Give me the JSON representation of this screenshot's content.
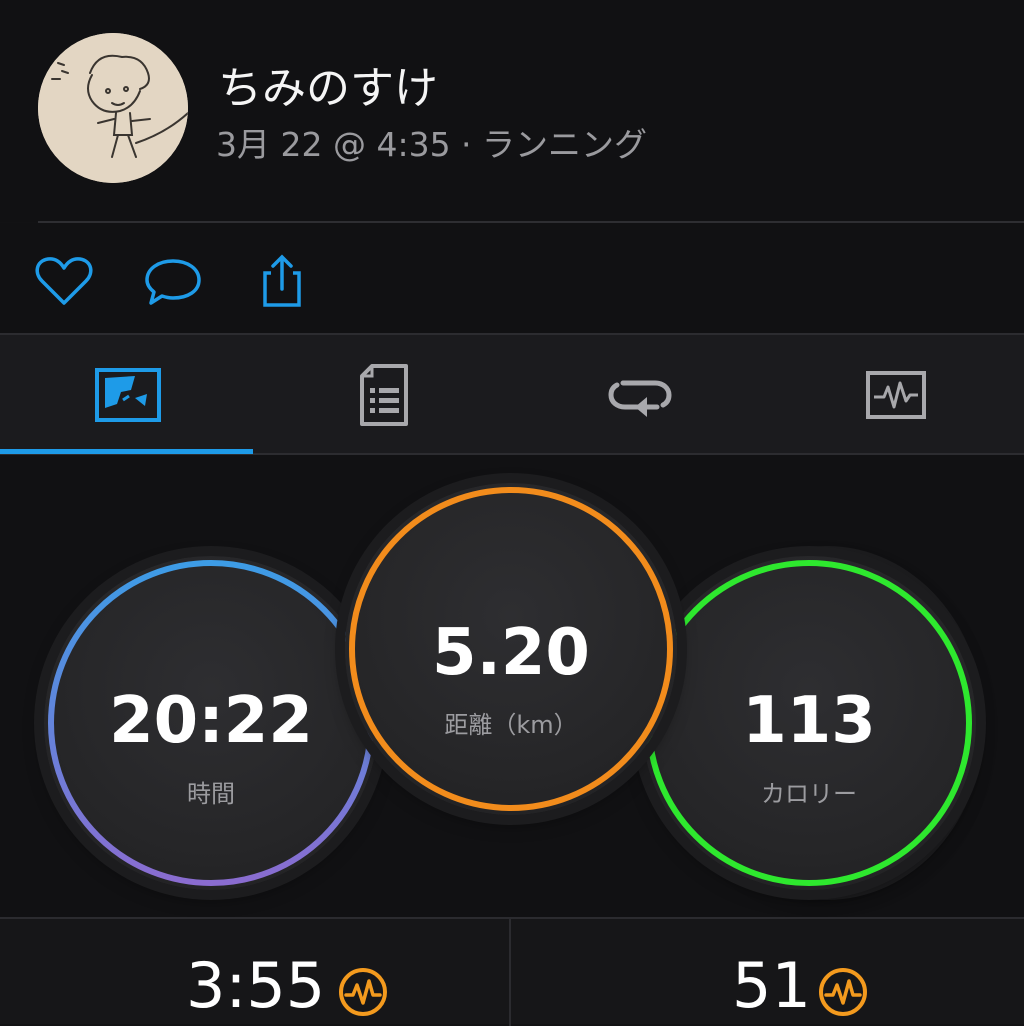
{
  "header": {
    "avatar_icon": "user-avatar-sketch",
    "username": "ちみのすけ",
    "meta": "3月 22 @ 4:35 · ランニング"
  },
  "actions": [
    {
      "icon": "heart-icon"
    },
    {
      "icon": "comment-icon"
    },
    {
      "icon": "share-icon"
    }
  ],
  "tabs": [
    {
      "icon": "map-overview-icon",
      "active": true
    },
    {
      "icon": "details-list-icon",
      "active": false
    },
    {
      "icon": "laps-icon",
      "active": false
    },
    {
      "icon": "charts-icon",
      "active": false
    }
  ],
  "stats": {
    "time": {
      "value": "20:22",
      "label": "時間"
    },
    "distance": {
      "value": "5.20",
      "label": "距離（km）"
    },
    "calories": {
      "value": "113",
      "label": "カロリー"
    }
  },
  "bottom": {
    "left_value": "3:55",
    "right_value": "51",
    "icon": "training-effect-icon"
  },
  "colors": {
    "accent_blue": "#1e9be8",
    "distance_orange": "#f28c1c",
    "calories_green": "#2ee82e",
    "time_ring_start": "#3d9ce6",
    "time_ring_end": "#8a6cd0",
    "metric_icon_orange": "#f39a1e"
  }
}
